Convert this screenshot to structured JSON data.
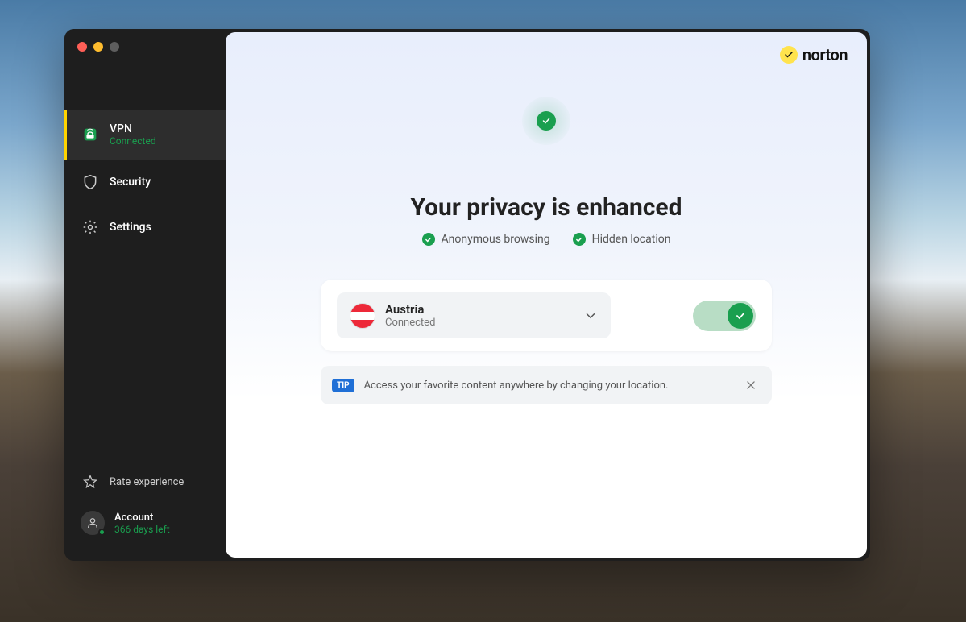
{
  "brand": {
    "name": "norton"
  },
  "sidebar": {
    "items": [
      {
        "label": "VPN",
        "sub": "Connected"
      },
      {
        "label": "Security"
      },
      {
        "label": "Settings"
      }
    ],
    "rate_label": "Rate experience",
    "account": {
      "label": "Account",
      "days_left": "366 days left"
    }
  },
  "main": {
    "headline": "Your privacy is enhanced",
    "features": [
      "Anonymous browsing",
      "Hidden location"
    ],
    "location": {
      "name": "Austria",
      "status": "Connected"
    },
    "tip": {
      "badge": "TIP",
      "text": "Access your favorite content anywhere by changing your location."
    }
  }
}
